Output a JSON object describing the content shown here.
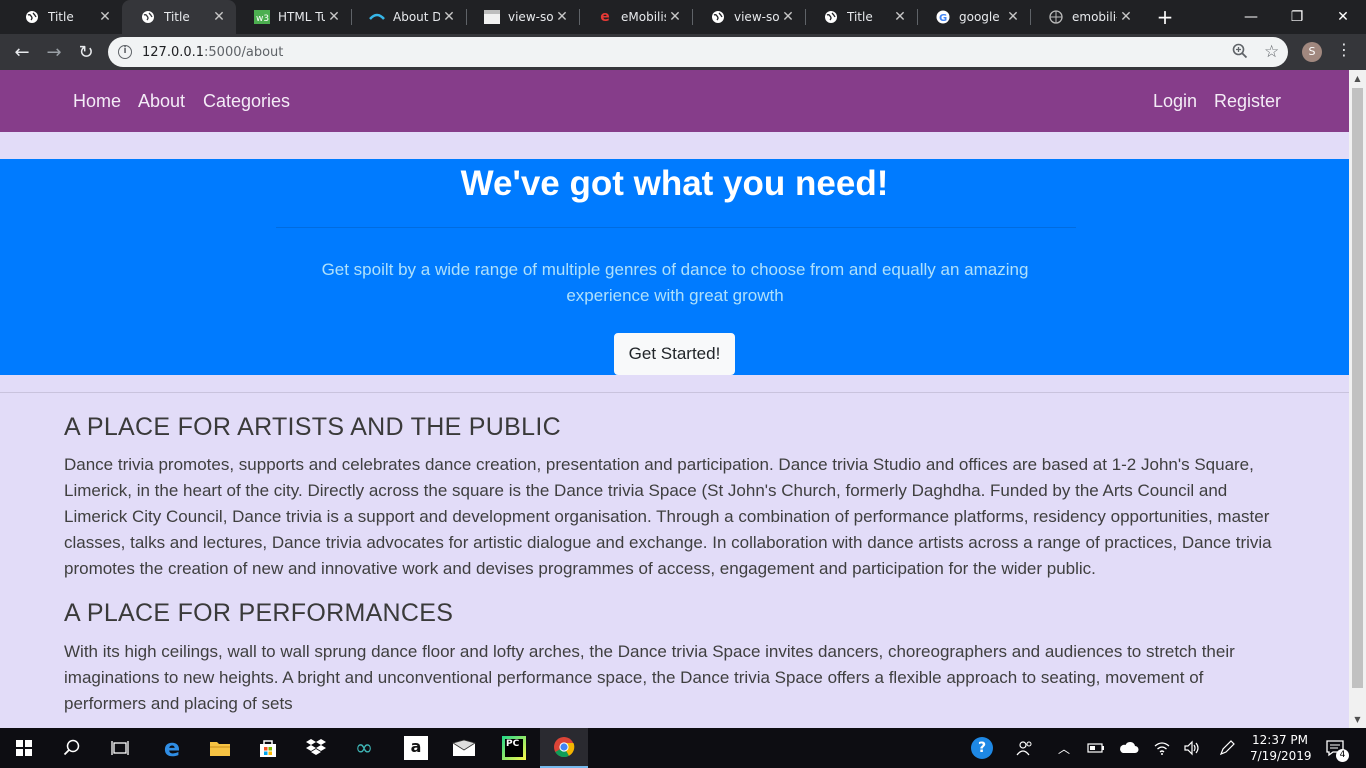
{
  "browser": {
    "tabs": [
      {
        "title": "Title",
        "favicon": "globe-icon"
      },
      {
        "title": "Title",
        "favicon": "globe-icon",
        "active": true
      },
      {
        "title": "HTML Tu",
        "favicon": "w3-icon"
      },
      {
        "title": "About Da",
        "favicon": "wave-icon"
      },
      {
        "title": "view-sou",
        "favicon": "page-icon"
      },
      {
        "title": "eMobilis",
        "favicon": "emobilis-icon"
      },
      {
        "title": "view-sou",
        "favicon": "globe-icon"
      },
      {
        "title": "Title",
        "favicon": "globe-icon"
      },
      {
        "title": "google ic",
        "favicon": "google-icon"
      },
      {
        "title": "emobili-s",
        "favicon": "globe-icon"
      }
    ],
    "url_host": "127.0.0.1",
    "url_rest": ":5000/about",
    "profile_initial": "S"
  },
  "nav": {
    "left": [
      "Home",
      "About",
      "Categories"
    ],
    "right": [
      "Login",
      "Register"
    ]
  },
  "hero": {
    "title": "We've got what you need!",
    "lead": "Get spoilt by a wide range of multiple genres of dance to choose from and equally an amazing experience with great growth",
    "button": "Get Started!"
  },
  "sections": [
    {
      "heading": "A PLACE FOR ARTISTS AND THE PUBLIC",
      "body": "Dance trivia promotes, supports and celebrates dance creation, presentation and participation. Dance trivia Studio and offices are based at 1-2 John's Square, Limerick, in the heart of the city. Directly across the square is the Dance trivia Space (St John's Church, formerly Daghdha. Funded by the Arts Council and Limerick City Council, Dance trivia is a support and development organisation. Through a combination of performance platforms, residency opportunities, master classes, talks and lectures, Dance trivia advocates for artistic dialogue and exchange. In collaboration with dance artists across a range of practices, Dance trivia promotes the creation of new and innovative work and devises programmes of access, engagement and participation for the wider public."
    },
    {
      "heading": "A PLACE FOR PERFORMANCES",
      "body": "With its high ceilings, wall to wall sprung dance floor and lofty arches, the Dance trivia Space invites dancers, choreographers and audiences to stretch their imaginations to new heights. A bright and unconventional performance space, the Dance trivia Space offers a flexible approach to seating, movement of performers and placing of sets"
    }
  ],
  "taskbar": {
    "time": "12:37 PM",
    "date": "7/19/2019",
    "notification_count": "4"
  },
  "colors": {
    "navbar": "#863d8a",
    "hero": "#007bff",
    "page_bg": "#e2dcf8"
  }
}
